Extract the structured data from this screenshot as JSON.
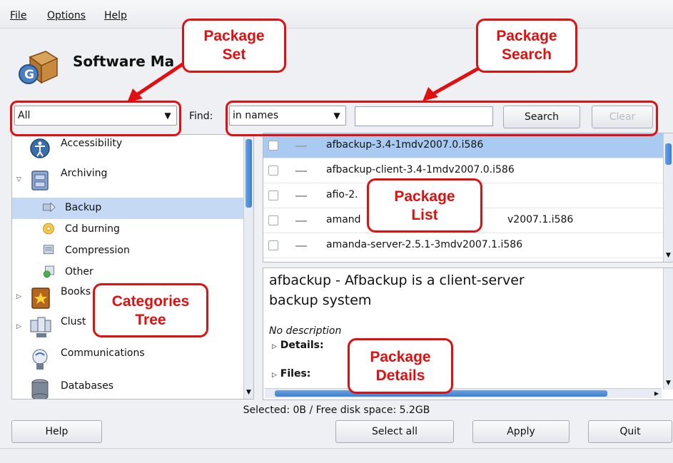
{
  "menu": {
    "file": "File",
    "options": "Options",
    "help": "Help"
  },
  "app": {
    "title": "Software Ma"
  },
  "toolbar": {
    "package_set_value": "All",
    "find_label": "Find:",
    "search_mode_value": "in names",
    "search_input_value": "",
    "search_button": "Search",
    "clear_button": "Clear"
  },
  "categories": [
    {
      "label": "Accessibility",
      "icon": "accessibility-icon",
      "level": 0,
      "expander": "none"
    },
    {
      "label": "Archiving",
      "icon": "archive-drawer-icon",
      "level": 0,
      "expander": "expanded"
    },
    {
      "label": "Backup",
      "icon": "backup-icon",
      "level": 1,
      "selected": true
    },
    {
      "label": "Cd burning",
      "icon": "cd-burning-icon",
      "level": 1
    },
    {
      "label": "Compression",
      "icon": "compression-icon",
      "level": 1
    },
    {
      "label": "Other",
      "icon": "other-icon",
      "level": 1
    },
    {
      "label": "Books",
      "icon": "books-icon",
      "level": 0,
      "expander": "collapsed"
    },
    {
      "label": "Clust",
      "icon": "cluster-icon",
      "level": 0,
      "expander": "collapsed"
    },
    {
      "label": "Communications",
      "icon": "communications-icon",
      "level": 0,
      "expander": "none"
    },
    {
      "label": "Databases",
      "icon": "database-icon",
      "level": 0,
      "expander": "none"
    }
  ],
  "packages": [
    {
      "name": "afbackup-3.4-1mdv2007.0.i586",
      "selected": true
    },
    {
      "name": "afbackup-client-3.4-1mdv2007.0.i586"
    },
    {
      "name": "afio-2."
    },
    {
      "name": "amand",
      "suffix": "v2007.1.i586"
    },
    {
      "name": "amanda-server-2.5.1-3mdv2007.1.i586"
    }
  ],
  "details": {
    "summary_line1": "afbackup - Afbackup is a client-server",
    "summary_line2": "backup system",
    "description": "No description",
    "details_label": "Details:",
    "files_label": "Files:"
  },
  "status": {
    "text": "Selected: 0B / Free disk space: 5.2GB"
  },
  "buttons": {
    "help": "Help",
    "select_all": "Select all",
    "apply": "Apply",
    "quit": "Quit"
  },
  "callouts": {
    "package_set": [
      "Package",
      "Set"
    ],
    "package_search": [
      "Package",
      "Search"
    ],
    "package_list": [
      "Package",
      "List"
    ],
    "categories_tree": [
      "Categories",
      "Tree"
    ],
    "package_details": [
      "Package",
      "Details"
    ]
  },
  "colors": {
    "annotation": "#e01010",
    "selection": "#a9cbf2",
    "tree_selection": "#c5d9f4",
    "scroll_thumb": "#3d7fd1"
  }
}
